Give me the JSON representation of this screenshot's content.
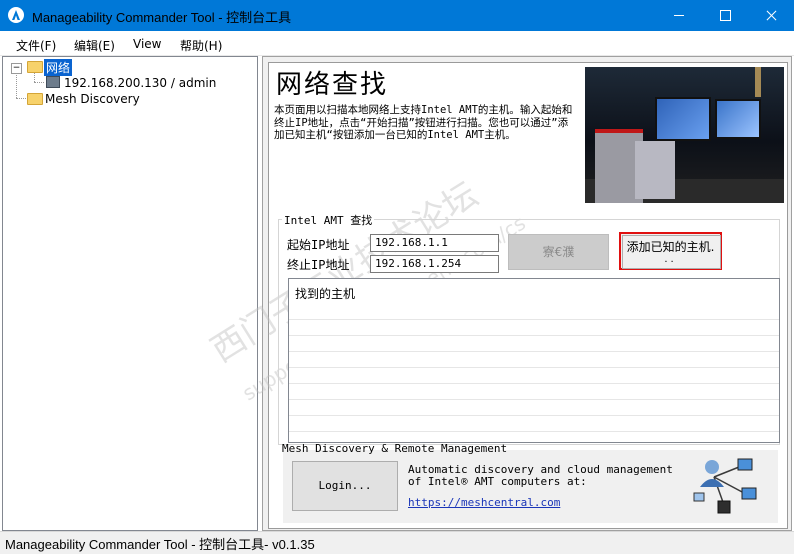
{
  "window": {
    "title": "Manageability Commander Tool - 控制台工具",
    "accent_color": "#0078d7",
    "controls": [
      "minimize-icon",
      "maximize-icon",
      "close-icon"
    ]
  },
  "menu": {
    "items": [
      {
        "label": "文件(F)"
      },
      {
        "label": "编辑(E)"
      },
      {
        "label": "View"
      },
      {
        "label": "帮助(H)"
      }
    ]
  },
  "tree": {
    "root": {
      "label": "网络",
      "icon": "folder-icon",
      "selected": true
    },
    "children": [
      {
        "label": "192.168.200.130 / admin",
        "icon": "computer-icon"
      }
    ],
    "sibling": {
      "label": "Mesh Discovery",
      "icon": "folder-icon"
    }
  },
  "main": {
    "title": "网络查找",
    "description": "本页面用以扫描本地网络上支持Intel AMT的主机。输入起始和终止IP地址，点击“开始扫描”按钮进行扫描。您也可以通过”添加已知主机“按钮添加一台已知的Intel AMT主机。",
    "search": {
      "legend": "Intel AMT 查找",
      "start_ip_label": "起始IP地址",
      "start_ip_value": "192.168.1.1",
      "end_ip_label": "终止IP地址",
      "end_ip_value": "192.168.1.254",
      "scan_button": "寮€濮",
      "add_known_host_button": "添加已知的主机.",
      "add_known_host_button_line2": "..",
      "found_hosts_header": "找到的主机"
    },
    "mesh": {
      "legend": "Mesh Discovery & Remote Management",
      "login_button": "Login...",
      "description": "Automatic discovery and cloud management of Intel® AMT computers at:",
      "link": "https://meshcentral.com",
      "icon": "network-icon"
    },
    "highlight_color": "#e01010"
  },
  "watermark": {
    "main": "西门子工业技术论坛",
    "sub": "support.industry.siemens.com/cs"
  },
  "status": {
    "text": "Manageability Commander Tool - 控制台工具- v0.1.35"
  }
}
